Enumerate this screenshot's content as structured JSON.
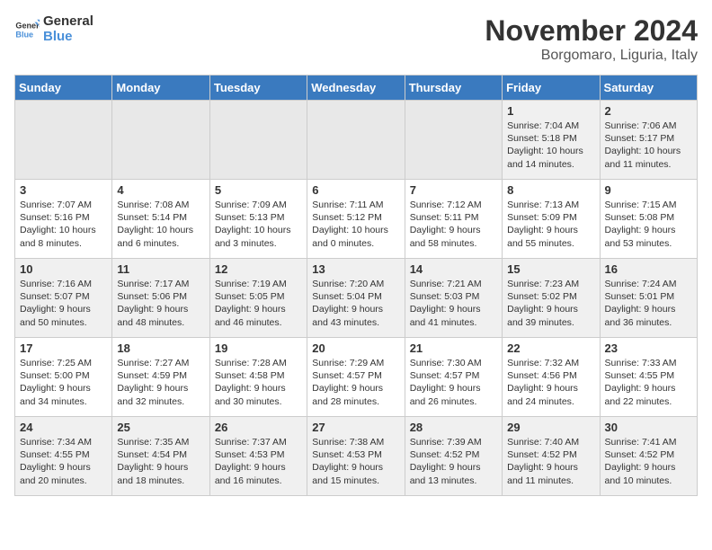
{
  "header": {
    "logo_line1": "General",
    "logo_line2": "Blue",
    "month": "November 2024",
    "location": "Borgomaro, Liguria, Italy"
  },
  "weekdays": [
    "Sunday",
    "Monday",
    "Tuesday",
    "Wednesday",
    "Thursday",
    "Friday",
    "Saturday"
  ],
  "weeks": [
    [
      {
        "day": "",
        "info": ""
      },
      {
        "day": "",
        "info": ""
      },
      {
        "day": "",
        "info": ""
      },
      {
        "day": "",
        "info": ""
      },
      {
        "day": "",
        "info": ""
      },
      {
        "day": "1",
        "info": "Sunrise: 7:04 AM\nSunset: 5:18 PM\nDaylight: 10 hours and 14 minutes."
      },
      {
        "day": "2",
        "info": "Sunrise: 7:06 AM\nSunset: 5:17 PM\nDaylight: 10 hours and 11 minutes."
      }
    ],
    [
      {
        "day": "3",
        "info": "Sunrise: 7:07 AM\nSunset: 5:16 PM\nDaylight: 10 hours and 8 minutes."
      },
      {
        "day": "4",
        "info": "Sunrise: 7:08 AM\nSunset: 5:14 PM\nDaylight: 10 hours and 6 minutes."
      },
      {
        "day": "5",
        "info": "Sunrise: 7:09 AM\nSunset: 5:13 PM\nDaylight: 10 hours and 3 minutes."
      },
      {
        "day": "6",
        "info": "Sunrise: 7:11 AM\nSunset: 5:12 PM\nDaylight: 10 hours and 0 minutes."
      },
      {
        "day": "7",
        "info": "Sunrise: 7:12 AM\nSunset: 5:11 PM\nDaylight: 9 hours and 58 minutes."
      },
      {
        "day": "8",
        "info": "Sunrise: 7:13 AM\nSunset: 5:09 PM\nDaylight: 9 hours and 55 minutes."
      },
      {
        "day": "9",
        "info": "Sunrise: 7:15 AM\nSunset: 5:08 PM\nDaylight: 9 hours and 53 minutes."
      }
    ],
    [
      {
        "day": "10",
        "info": "Sunrise: 7:16 AM\nSunset: 5:07 PM\nDaylight: 9 hours and 50 minutes."
      },
      {
        "day": "11",
        "info": "Sunrise: 7:17 AM\nSunset: 5:06 PM\nDaylight: 9 hours and 48 minutes."
      },
      {
        "day": "12",
        "info": "Sunrise: 7:19 AM\nSunset: 5:05 PM\nDaylight: 9 hours and 46 minutes."
      },
      {
        "day": "13",
        "info": "Sunrise: 7:20 AM\nSunset: 5:04 PM\nDaylight: 9 hours and 43 minutes."
      },
      {
        "day": "14",
        "info": "Sunrise: 7:21 AM\nSunset: 5:03 PM\nDaylight: 9 hours and 41 minutes."
      },
      {
        "day": "15",
        "info": "Sunrise: 7:23 AM\nSunset: 5:02 PM\nDaylight: 9 hours and 39 minutes."
      },
      {
        "day": "16",
        "info": "Sunrise: 7:24 AM\nSunset: 5:01 PM\nDaylight: 9 hours and 36 minutes."
      }
    ],
    [
      {
        "day": "17",
        "info": "Sunrise: 7:25 AM\nSunset: 5:00 PM\nDaylight: 9 hours and 34 minutes."
      },
      {
        "day": "18",
        "info": "Sunrise: 7:27 AM\nSunset: 4:59 PM\nDaylight: 9 hours and 32 minutes."
      },
      {
        "day": "19",
        "info": "Sunrise: 7:28 AM\nSunset: 4:58 PM\nDaylight: 9 hours and 30 minutes."
      },
      {
        "day": "20",
        "info": "Sunrise: 7:29 AM\nSunset: 4:57 PM\nDaylight: 9 hours and 28 minutes."
      },
      {
        "day": "21",
        "info": "Sunrise: 7:30 AM\nSunset: 4:57 PM\nDaylight: 9 hours and 26 minutes."
      },
      {
        "day": "22",
        "info": "Sunrise: 7:32 AM\nSunset: 4:56 PM\nDaylight: 9 hours and 24 minutes."
      },
      {
        "day": "23",
        "info": "Sunrise: 7:33 AM\nSunset: 4:55 PM\nDaylight: 9 hours and 22 minutes."
      }
    ],
    [
      {
        "day": "24",
        "info": "Sunrise: 7:34 AM\nSunset: 4:55 PM\nDaylight: 9 hours and 20 minutes."
      },
      {
        "day": "25",
        "info": "Sunrise: 7:35 AM\nSunset: 4:54 PM\nDaylight: 9 hours and 18 minutes."
      },
      {
        "day": "26",
        "info": "Sunrise: 7:37 AM\nSunset: 4:53 PM\nDaylight: 9 hours and 16 minutes."
      },
      {
        "day": "27",
        "info": "Sunrise: 7:38 AM\nSunset: 4:53 PM\nDaylight: 9 hours and 15 minutes."
      },
      {
        "day": "28",
        "info": "Sunrise: 7:39 AM\nSunset: 4:52 PM\nDaylight: 9 hours and 13 minutes."
      },
      {
        "day": "29",
        "info": "Sunrise: 7:40 AM\nSunset: 4:52 PM\nDaylight: 9 hours and 11 minutes."
      },
      {
        "day": "30",
        "info": "Sunrise: 7:41 AM\nSunset: 4:52 PM\nDaylight: 9 hours and 10 minutes."
      }
    ]
  ]
}
